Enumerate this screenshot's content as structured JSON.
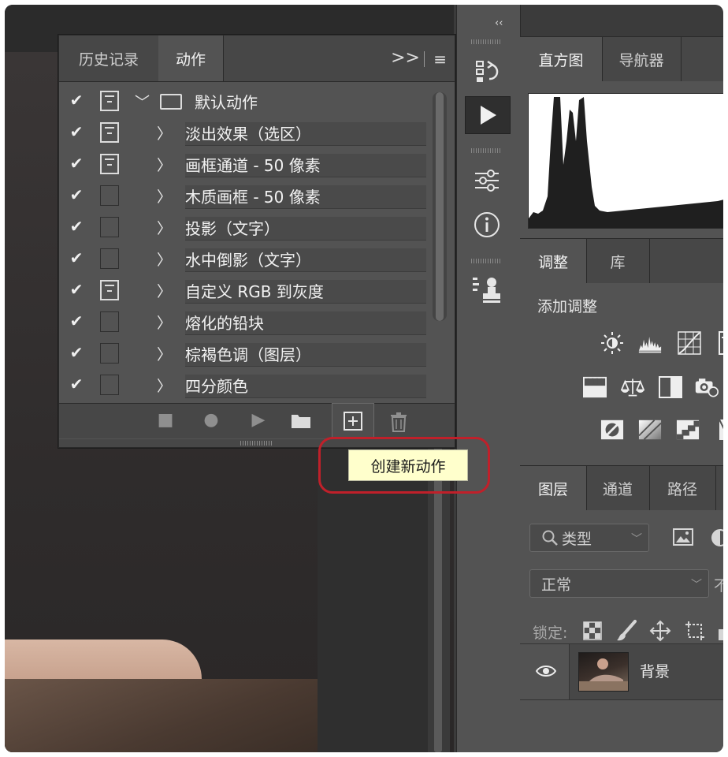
{
  "panel_actions": {
    "tabs": [
      "历史记录",
      "动作"
    ],
    "active_tab": "动作",
    "expand_glyph": ">>",
    "menu_glyph": "≡",
    "set_name": "默认动作",
    "items": [
      {
        "label": "淡出效果（选区）",
        "dialog": true
      },
      {
        "label": "画框通道 - 50 像素",
        "dialog": true
      },
      {
        "label": "木质画框 - 50 像素",
        "dialog": false
      },
      {
        "label": "投影（文字）",
        "dialog": false
      },
      {
        "label": "水中倒影（文字）",
        "dialog": false
      },
      {
        "label": "自定义 RGB 到灰度",
        "dialog": true
      },
      {
        "label": "熔化的铅块",
        "dialog": false
      },
      {
        "label": "棕褐色调（图层）",
        "dialog": false
      },
      {
        "label": "四分颜色",
        "dialog": false
      }
    ],
    "bottom_bar": {
      "stop_icon": "stop-icon",
      "record_icon": "record-icon",
      "play_icon": "play-icon",
      "new_set_icon": "folder-icon",
      "new_action_icon": "plus-square-icon",
      "delete_icon": "trash-icon"
    },
    "tooltip": "创建新动作",
    "highlight_color": "#c0202a"
  },
  "dock": {
    "collapse_glyph": "‹‹",
    "buttons": [
      "history-panel-icon",
      "actions-play-icon",
      "adjustments-sliders-icon",
      "info-icon",
      "clone-source-icon"
    ]
  },
  "panel_histogram": {
    "tabs": [
      "直方图",
      "导航器"
    ],
    "active_tab": "直方图"
  },
  "panel_adjustments": {
    "tabs": [
      "调整",
      "库"
    ],
    "active_tab": "调整",
    "title": "添加调整"
  },
  "panel_layers": {
    "tabs": [
      "图层",
      "通道",
      "路径"
    ],
    "active_tab": "图层",
    "filter_label": "类型",
    "blend_mode": "正常",
    "opacity_prefix": "不",
    "lock_label": "锁定:",
    "layer_name": "背景"
  },
  "colors": {
    "panel_bg": "#535353",
    "tab_bg": "#474747",
    "tooltip_bg": "#ffffcc",
    "accent_red": "#c0202a"
  }
}
